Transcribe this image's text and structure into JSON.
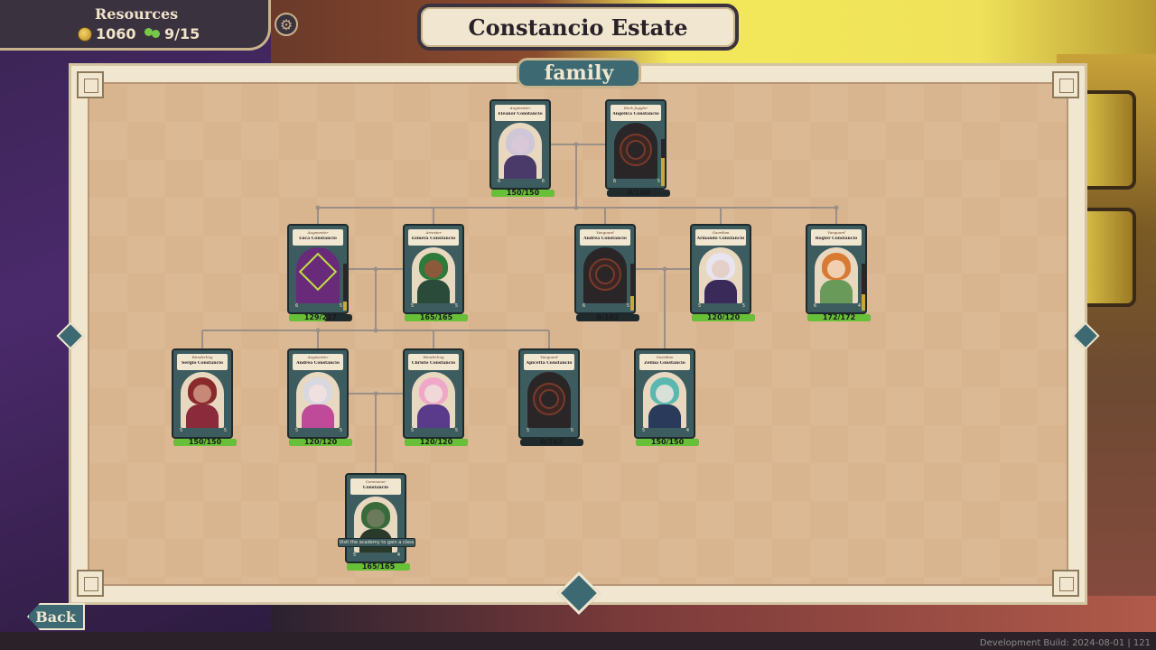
{
  "resources": {
    "title": "Resources",
    "gold": "1060",
    "family_count": "9/15"
  },
  "estate": {
    "title": "Constancio Estate"
  },
  "tab": {
    "label": "family"
  },
  "members": [
    {
      "id": "m1",
      "role": "Augmenter",
      "name": "Eleanor Constancio",
      "hp": "150/150",
      "hp_fraction": 1.0,
      "stat_left": "6",
      "stat_right": "6",
      "portrait": "pale-purple",
      "dark": false
    },
    {
      "id": "m2",
      "role": "Rock Juggler",
      "name": "Angelica Constancio",
      "hp": "0/160",
      "hp_fraction": 0.0,
      "stat_left": "6",
      "stat_right": "5",
      "portrait": "sigil",
      "dark": true,
      "gauge": 0.6
    },
    {
      "id": "m3",
      "role": "Augmenter",
      "name": "Luca Constancio",
      "hp": "129/217",
      "hp_fraction": 0.59,
      "stat_left": "6",
      "stat_right": "5",
      "portrait": "purple-sigil",
      "dark": false,
      "gauge": 0.2
    },
    {
      "id": "m4",
      "role": "Arrester",
      "name": "Ezmera Constancio",
      "hp": "165/165",
      "hp_fraction": 1.0,
      "stat_left": "5",
      "stat_right": "5",
      "portrait": "green-hair",
      "dark": false
    },
    {
      "id": "m5",
      "role": "Vanguard",
      "name": "Andrea Constancio",
      "hp": "0/162",
      "hp_fraction": 0.0,
      "stat_left": "6",
      "stat_right": "5",
      "portrait": "sigil",
      "dark": true,
      "gauge": 0.3
    },
    {
      "id": "m6",
      "role": "Guardian",
      "name": "Armando Constancio",
      "hp": "120/120",
      "hp_fraction": 1.0,
      "stat_left": "5",
      "stat_right": "5",
      "portrait": "white-hair",
      "dark": false
    },
    {
      "id": "m7",
      "role": "Vanguard",
      "name": "Rogier Constancio",
      "hp": "172/172",
      "hp_fraction": 1.0,
      "stat_left": "6",
      "stat_right": "4",
      "portrait": "orange-hair",
      "dark": false,
      "gauge": 0.35
    },
    {
      "id": "m8",
      "role": "Wanderling",
      "name": "Sergio Constancio",
      "hp": "150/150",
      "hp_fraction": 1.0,
      "stat_left": "5",
      "stat_right": "5",
      "portrait": "red-hair",
      "dark": false
    },
    {
      "id": "m9",
      "role": "Augmenter",
      "name": "Andrea Constancio",
      "hp": "120/120",
      "hp_fraction": 1.0,
      "stat_left": "5",
      "stat_right": "5",
      "portrait": "silver-hair",
      "dark": false
    },
    {
      "id": "m10",
      "role": "Wanderling",
      "name": "Christo Constancio",
      "hp": "120/120",
      "hp_fraction": 1.0,
      "stat_left": "5",
      "stat_right": "5",
      "portrait": "pink-hair",
      "dark": false
    },
    {
      "id": "m11",
      "role": "Vanguard",
      "name": "Apicetta Constancio",
      "hp": "0/162",
      "hp_fraction": 0.0,
      "stat_left": "5",
      "stat_right": "5",
      "portrait": "sigil",
      "dark": true
    },
    {
      "id": "m12",
      "role": "Guardian",
      "name": "Zelina Constancio",
      "hp": "150/150",
      "hp_fraction": 1.0,
      "stat_left": "5",
      "stat_right": "4",
      "portrait": "teal-hair",
      "dark": false
    },
    {
      "id": "m13",
      "role": "Commoner",
      "name": "Constancio",
      "hp": "165/165",
      "hp_fraction": 1.0,
      "stat_left": "5",
      "stat_right": "4",
      "portrait": "green-hood",
      "dark": false
    }
  ],
  "tooltip": "Visit the academy to gain a class",
  "back_button": "Back",
  "dev_build": "Development Build: 2024-08-01 | 121",
  "colors": {
    "hp_bar": "#68c038",
    "card_frame": "#3d5c60",
    "panel_teal": "#3d6a72",
    "parchment": "#f1e6cf"
  }
}
